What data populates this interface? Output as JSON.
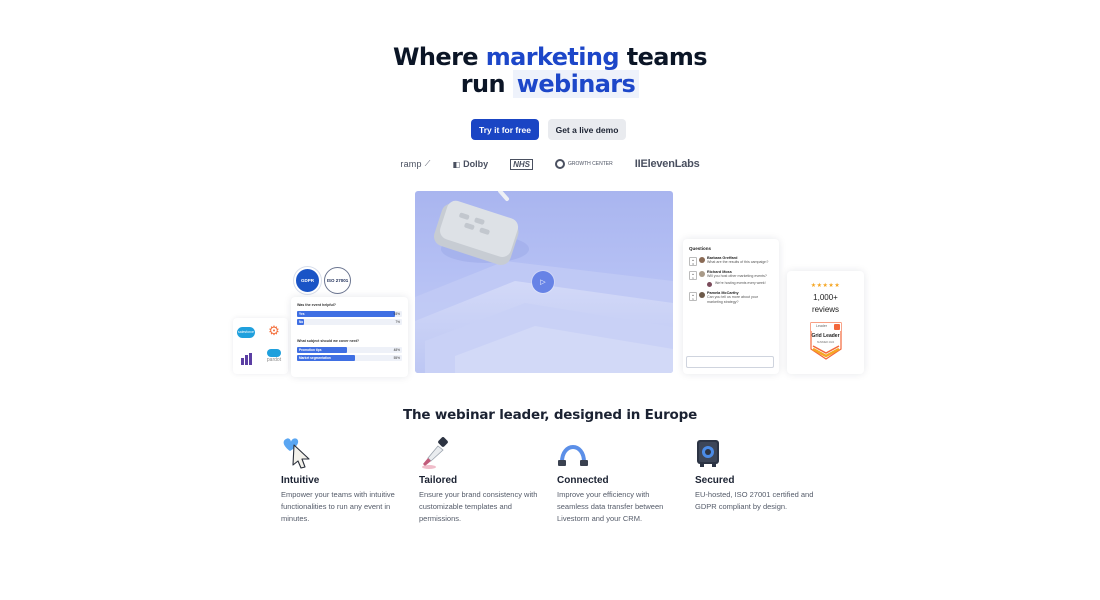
{
  "hero": {
    "line1_pre": "Where ",
    "line1_accent": "marketing",
    "line1_post": " teams",
    "line2_pre": "run ",
    "line2_accent": "webinars"
  },
  "cta": {
    "primary_label": "Try it for free",
    "secondary_label": "Get a live demo"
  },
  "logos": [
    "ramp",
    "Dolby",
    "NHS",
    "GROWTH CENTER",
    "IIElevenLabs"
  ],
  "integrations": {
    "salesforce_label": "salesforce",
    "pardot_label": "pardot"
  },
  "badges": {
    "gdpr": "GDPR",
    "iso": "ISO 27001"
  },
  "poll": {
    "q1": "Was the event helpful?",
    "q1_options": [
      {
        "label": "Yes",
        "percent": 93,
        "pct_text": "93%"
      },
      {
        "label": "No",
        "percent": 7,
        "pct_text": "7%"
      }
    ],
    "q2": "What subject should we cover next?",
    "q2_options": [
      {
        "label": "Promotion tips",
        "percent": 48,
        "pct_text": "48%"
      },
      {
        "label": "Market segmentation",
        "percent": 55,
        "pct_text": "55%"
      }
    ]
  },
  "video": {
    "play_icon": "play-icon"
  },
  "questions": {
    "title": "Questions",
    "items": [
      {
        "votes": "3",
        "name": "Barbara Greffard",
        "text": "What are the results of this campaign?"
      },
      {
        "votes": "1",
        "name": "Richard Moss",
        "text": "Will you host other marketing events?",
        "reply": "We're hosting events every week!"
      },
      {
        "votes": "1",
        "name": "Pamela McCarthy",
        "text": "Can you tell us more about your marketing strategy?"
      }
    ]
  },
  "reviews": {
    "stars": "★★★★★",
    "count_line1": "1,000+",
    "count_line2": "reviews",
    "badge_top": "Leader",
    "badge_main": "Grid Leader",
    "badge_season": "SUMMER 2024"
  },
  "section": {
    "title": "The webinar leader, designed in Europe"
  },
  "features": [
    {
      "icon": "heart-cursor-icon",
      "title": "Intuitive",
      "desc": "Empower your teams with intuitive functionalities to run any event in minutes."
    },
    {
      "icon": "paint-dropper-icon",
      "title": "Tailored",
      "desc": "Ensure your brand consistency with customizable templates and permissions."
    },
    {
      "icon": "connected-arc-icon",
      "title": "Connected",
      "desc": "Improve your efficiency with seamless data transfer between Livestorm and your CRM."
    },
    {
      "icon": "vault-icon",
      "title": "Secured",
      "desc": "EU-hosted, ISO 27001 certified and GDPR compliant by design."
    }
  ],
  "colors": {
    "accent": "#1d47c9",
    "primary_button": "#1a45c4",
    "secondary_button": "#e9ebef"
  }
}
